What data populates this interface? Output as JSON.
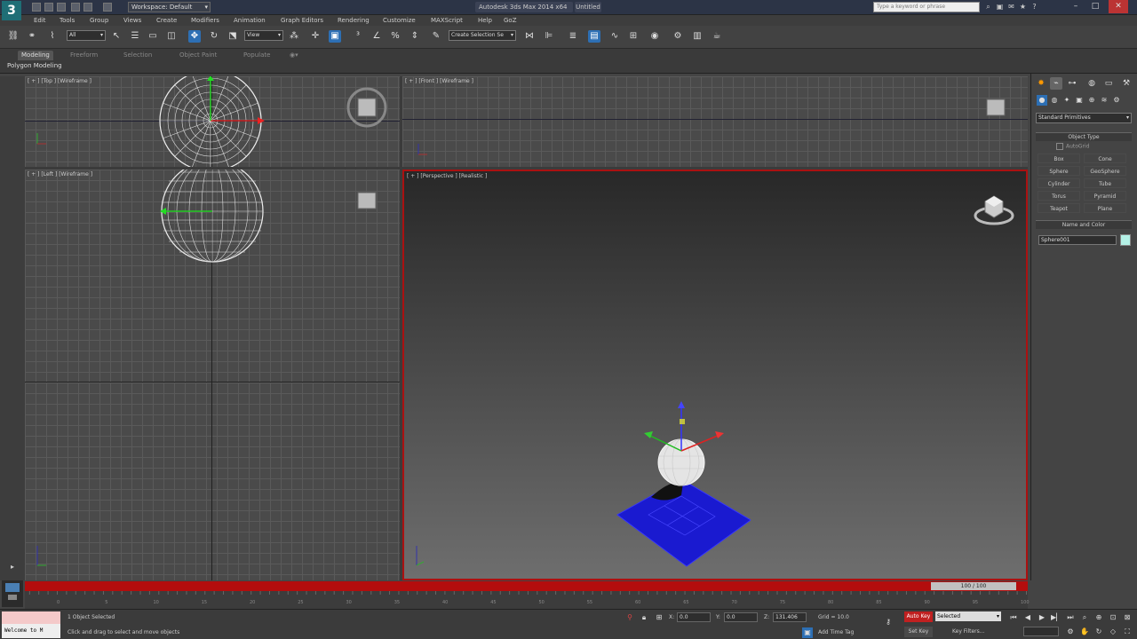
{
  "title_bar": {
    "app_logo": "3",
    "workspace": "Workspace: Default",
    "document": "Autodesk 3ds Max  2014 x64",
    "document_suffix": "Untitled",
    "search_placeholder": "Type a keyword or phrase"
  },
  "menu": [
    "Edit",
    "Tools",
    "Group",
    "Views",
    "Create",
    "Modifiers",
    "Animation",
    "Graph Editors",
    "Rendering",
    "Customize",
    "MAXScript",
    "Help",
    "GoZ"
  ],
  "toolbar": {
    "selection_set": "All",
    "ref_coord": "View",
    "named_selection": "Create Selection Se"
  },
  "ribbon": {
    "tabs": [
      "Modeling",
      "Freeform",
      "Selection",
      "Object Paint",
      "Populate"
    ],
    "panel_label": "Polygon Modeling"
  },
  "viewports": {
    "top": "[ + ] [Top ] [Wireframe ]",
    "front": "[ + ] [Front ] [Wireframe ]",
    "left": "[ + ] [Left ] [Wireframe ]",
    "perspective": "[ + ] [Perspective ] [Realistic ]"
  },
  "command_panel": {
    "primitive_type": "Standard Primitives",
    "object_type_title": "Object Type",
    "autogrid": "AutoGrid",
    "buttons": [
      "Box",
      "Cone",
      "Sphere",
      "GeoSphere",
      "Cylinder",
      "Tube",
      "Torus",
      "Pyramid",
      "Teapot",
      "Plane"
    ],
    "name_color_title": "Name and Color",
    "object_name": "Sphere001",
    "object_color": "#b4f1e6"
  },
  "timeline": {
    "slider": "100 / 100",
    "ticks": [
      "0",
      "5",
      "10",
      "15",
      "20",
      "25",
      "30",
      "35",
      "40",
      "45",
      "50",
      "55",
      "60",
      "65",
      "70",
      "75",
      "80",
      "85",
      "90",
      "95",
      "100"
    ]
  },
  "status": {
    "maxscript": "Welcome to M",
    "line1": "1 Object Selected",
    "line2": "Click and drag to select and move objects",
    "x_label": "X:",
    "x_value": "0.0",
    "y_label": "Y:",
    "y_value": "0.0",
    "z_label": "Z:",
    "z_value": "131.406",
    "grid": "Grid = 10.0",
    "add_time_tag": "Add Time Tag",
    "auto_key": "Auto Key",
    "selected": "Selected",
    "set_key": "Set Key",
    "key_filters": "Key Filters..."
  }
}
